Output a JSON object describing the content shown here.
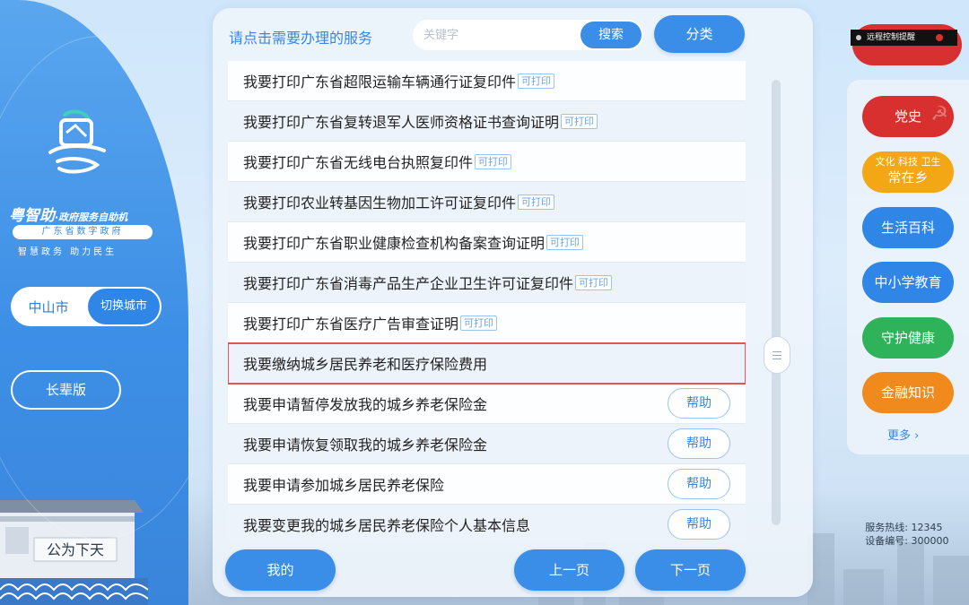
{
  "left": {
    "brand_title": "粤智助",
    "brand_suffix": "·政府服务自助机",
    "brand_pill": "广东省数字政府",
    "brand_slogan": "智慧政务  助力民生",
    "city_name": "中山市",
    "city_switch_label": "切换城市",
    "elder_mode_label": "长辈版",
    "building_inscription": "公为下天"
  },
  "main": {
    "title": "请点击需要办理的服务",
    "search": {
      "placeholder": "关键字",
      "button_label": "搜索"
    },
    "category_label": "分类",
    "print_tag": "可打印",
    "help_label": "帮助",
    "services": [
      {
        "label": "我要打印广东省超限运输车辆通行证复印件",
        "printable": true,
        "help": false,
        "selected": false
      },
      {
        "label": "我要打印广东省复转退军人医师资格证书查询证明",
        "printable": true,
        "help": false,
        "selected": false
      },
      {
        "label": "我要打印广东省无线电台执照复印件",
        "printable": true,
        "help": false,
        "selected": false
      },
      {
        "label": "我要打印农业转基因生物加工许可证复印件",
        "printable": true,
        "help": false,
        "selected": false
      },
      {
        "label": "我要打印广东省职业健康检查机构备案查询证明",
        "printable": true,
        "help": false,
        "selected": false
      },
      {
        "label": "我要打印广东省消毒产品生产企业卫生许可证复印件",
        "printable": true,
        "help": false,
        "selected": false
      },
      {
        "label": "我要打印广东省医疗广告审查证明",
        "printable": true,
        "help": false,
        "selected": false
      },
      {
        "label": "我要缴纳城乡居民养老和医疗保险费用",
        "printable": false,
        "help": false,
        "selected": true
      },
      {
        "label": "我要申请暂停发放我的城乡养老保险金",
        "printable": false,
        "help": true,
        "selected": false
      },
      {
        "label": "我要申请恢复领取我的城乡养老保险金",
        "printable": false,
        "help": true,
        "selected": false
      },
      {
        "label": "我要申请参加城乡居民养老保险",
        "printable": false,
        "help": true,
        "selected": false
      },
      {
        "label": "我要变更我的城乡居民养老保险个人基本信息",
        "printable": false,
        "help": true,
        "selected": false
      }
    ],
    "mine_label": "我的",
    "prev_label": "上一页",
    "next_label": "下一页"
  },
  "right": {
    "remote_notice": "远程控制提醒",
    "categories": [
      {
        "sub": "",
        "label": "党史",
        "color": "#d7302e",
        "icon": "party-emblem-icon"
      },
      {
        "sub": "文化 科技 卫生",
        "label": "常在乡",
        "color": "#f4a714",
        "icon": ""
      },
      {
        "sub": "",
        "label": "生活百科",
        "color": "#2f86e6",
        "icon": ""
      },
      {
        "sub": "",
        "label": "中小学教育",
        "color": "#2f86e6",
        "icon": ""
      },
      {
        "sub": "",
        "label": "守护健康",
        "color": "#2fb35a",
        "icon": ""
      },
      {
        "sub": "",
        "label": "金融知识",
        "color": "#f08a1c",
        "icon": ""
      }
    ],
    "more_label": "更多 ›",
    "hotline_label": "服务热线:",
    "hotline_value": "12345",
    "device_label": "设备编号:",
    "device_value": "300000"
  }
}
